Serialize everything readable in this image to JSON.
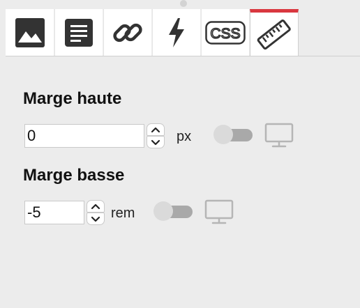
{
  "tabs": [
    {
      "icon": "image-icon",
      "active": false
    },
    {
      "icon": "document-icon",
      "active": false
    },
    {
      "icon": "link-icon",
      "active": false
    },
    {
      "icon": "lightning-icon",
      "active": false
    },
    {
      "icon": "css-icon",
      "text": "CSS",
      "active": false
    },
    {
      "icon": "ruler-icon",
      "active": true
    }
  ],
  "colors": {
    "active_tab_accent": "#d9373f",
    "background": "#ececec"
  },
  "margin_top": {
    "label": "Marge haute",
    "value": "0",
    "unit": "px"
  },
  "margin_bottom": {
    "label": "Marge basse",
    "value": "-5",
    "unit": "rem"
  }
}
